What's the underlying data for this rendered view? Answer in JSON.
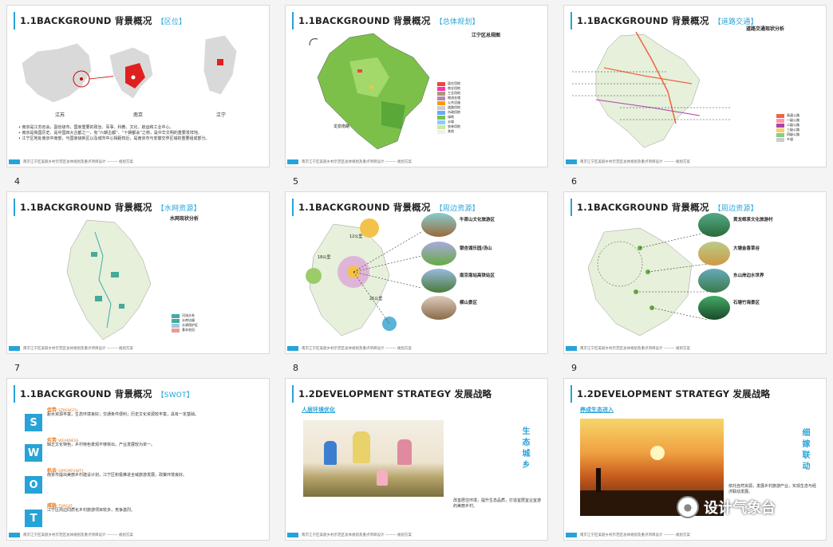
{
  "slides": [
    {
      "title": "1.1BACKGROUND 背景概况",
      "tag": "【区位】",
      "labels": [
        "江苏",
        "南京",
        "江宁"
      ],
      "bullets": [
        "• 南京是江苏省会，副省级市，国家重要的政治、军事、科教、文化、航运和工业中心。",
        "• 南京是我国历史、是中国四大古都之一，有“六朝古都”、“十朝都会”之称，是中华文明的重要发祥地。",
        "• 江宁区地处南京中南部，与国家级新区以及城市中心相距较近，是南京市与安徽交界区域的重要组成部分。"
      ]
    },
    {
      "title": "1.1BACKGROUND 背景概况",
      "tag": "【总体规划】",
      "subtitle": "江宁区总规图",
      "road": "龙泉南路",
      "legend": [
        "居住用地",
        "商业用地",
        "工业用地",
        "物流仓储",
        "公共设施",
        "道路用地",
        "市政用地",
        "绿地",
        "水域",
        "农林用地",
        "其他"
      ]
    },
    {
      "title": "1.1BACKGROUND 背景概况",
      "tag": "【道路交通】",
      "subtitle": "道路交通现状分析",
      "legend": [
        "高速公路",
        "一级公路",
        "二级公路",
        "三级公路",
        "四级公路",
        "乡道"
      ]
    },
    {
      "title": "1.1BACKGROUND 背景概况",
      "tag": "【水网资源】",
      "subtitle": "水网现状分析",
      "legend": [
        "河流水系",
        "水库坑塘",
        "水源保护区",
        "基本农田"
      ]
    },
    {
      "title": "1.1BACKGROUND 背景概况",
      "tag": "【周边资源】",
      "places": [
        "牛首山文化旅游区",
        "银杏湖乐园/汤山",
        "南京南站高铁站区",
        "横山景区"
      ],
      "distances": [
        "12公里",
        "18公里",
        "25公里"
      ]
    },
    {
      "title": "1.1BACKGROUND 背景概况",
      "tag": "【周边资源】",
      "places": [
        "黄龙岘茶文化旅游村",
        "大塘金香草谷",
        "东山岸边水世界",
        "石塘竹海景区"
      ]
    },
    {
      "title": "1.1BACKGROUND 背景概况",
      "tag": "【SWOT】",
      "swot": [
        {
          "letter": "S",
          "name": "优势",
          "en": "STRENGTH",
          "text": "距水资源丰富，生态环境良好；交通条件便利；历史文化资源较丰富，具有一定基础。"
        },
        {
          "letter": "W",
          "name": "劣势",
          "en": "WEAKNESS",
          "text": "缺乏文化特色，乡村特色景观不够突出，产业发展较为单一。"
        },
        {
          "letter": "O",
          "name": "机会",
          "en": "OPPORTUNITY",
          "text": "南京市提出美丽乡村建设计划，江宁区积极推进全域旅游发展，政策环境良好。"
        },
        {
          "letter": "T",
          "name": "威胁",
          "en": "THREAT",
          "text": "江宁区周边同质化乡村旅游项目较多，竞争激烈。"
        }
      ]
    },
    {
      "title": "1.2DEVELOPMENT STRATEGY 发展战略",
      "heading": "人居环境优化",
      "side": "生态城乡",
      "caption": "改善居住环境，提升生态品质，打造宜居宜业宜游的美丽乡村。"
    },
    {
      "title": "1.2DEVELOPMENT STRATEGY 发展战略",
      "heading": "养成生态进入",
      "side": "细嫁联动",
      "caption": "依托自然资源，发展乡村旅游产业，实现生态与经济联动发展。"
    }
  ],
  "page_numbers": [
    "4",
    "5",
    "6",
    "7",
    "8",
    "9"
  ],
  "footer_text": "南京江宁区美丽乡村示范区总体规划及重点项目设计 ——— 规划方案",
  "watermark": "设计气象台"
}
